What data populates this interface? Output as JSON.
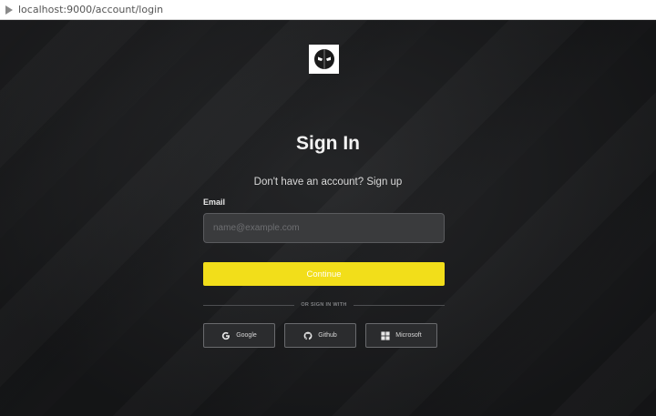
{
  "browser": {
    "url": "localhost:9000/account/login"
  },
  "login": {
    "title": "Sign In",
    "subtitle_prefix": "Don't have an account?",
    "signup_link": "Sign up",
    "email_label": "Email",
    "email_placeholder": "name@example.com",
    "continue_label": "Continue",
    "divider_text": "OR SIGN IN WITH",
    "social": {
      "google": "Google",
      "github": "Github",
      "microsoft": "Microsoft"
    }
  },
  "colors": {
    "background": "#1c1d1f",
    "accent": "#f2de1a",
    "input_bg": "#3a3b3d"
  }
}
